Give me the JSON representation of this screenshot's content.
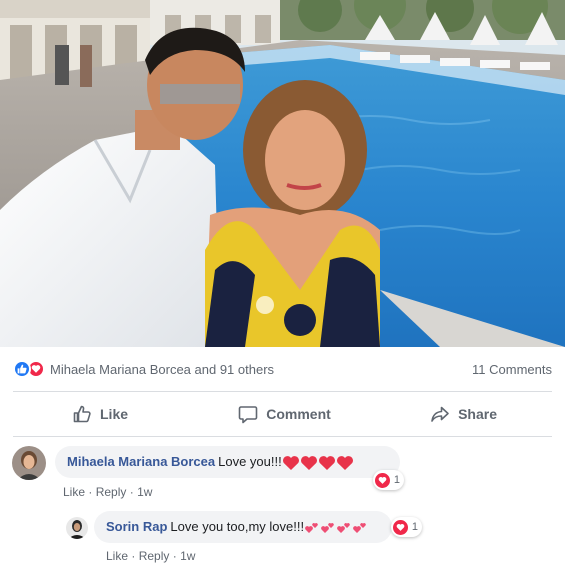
{
  "post": {
    "photo_alt": "",
    "reactions": {
      "icons": [
        "like-icon",
        "love-icon"
      ],
      "summary": "Mihaela Mariana Borcea and 91 others",
      "comments_count": "11 Comments"
    },
    "actions": {
      "like": "Like",
      "comment": "Comment",
      "share": "Share"
    }
  },
  "comments": [
    {
      "author": "Mihaela Mariana Borcea",
      "text": "Love you!!!",
      "emojis": [
        "red-heart",
        "red-heart",
        "red-heart",
        "red-heart"
      ],
      "like_label": "Like",
      "reply_label": "Reply",
      "separator": "·",
      "time": "1w",
      "reaction_count": "1"
    },
    {
      "author": "Sorin Rap",
      "text": "Love you too,my love!!!",
      "emojis": [
        "heart-kiss",
        "heart-kiss",
        "heart-kiss",
        "heart-kiss"
      ],
      "like_label": "Like",
      "reply_label": "Reply",
      "separator": "·",
      "time": "1w",
      "reaction_count": "1"
    }
  ],
  "colors": {
    "like_blue": "#2078f4",
    "love_red": "#f0284a",
    "author_link": "#385898",
    "meta_gray": "#606770",
    "bubble_bg": "#f2f3f5"
  }
}
